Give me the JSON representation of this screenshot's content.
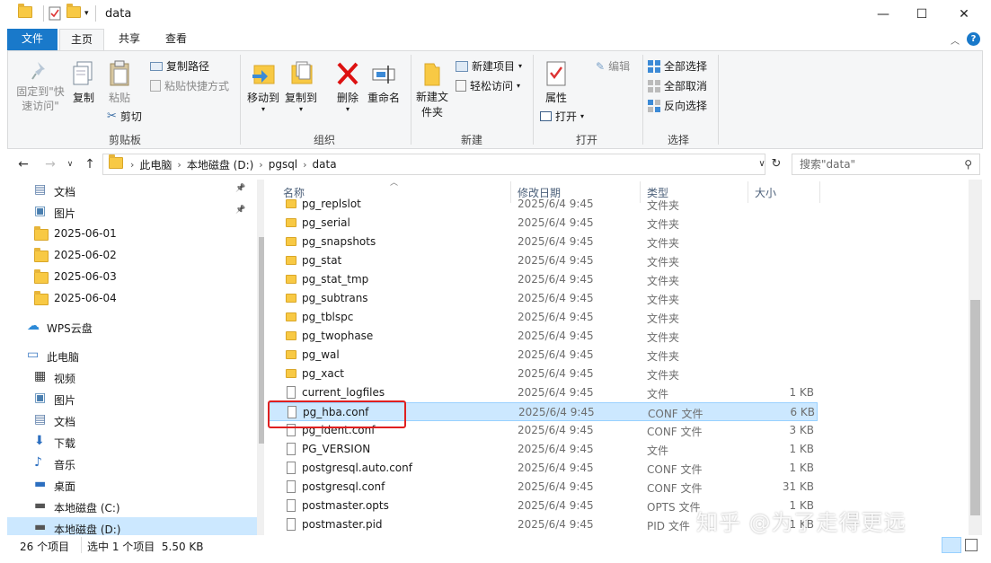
{
  "window": {
    "title": "data",
    "minimize": "—",
    "maximize": "☐",
    "close": "✕"
  },
  "ribbon_tabs": {
    "file": "文件",
    "home": "主页",
    "share": "共享",
    "view": "查看"
  },
  "ribbon": {
    "clipboard": {
      "pin": "固定到\"快速访问\"",
      "copy": "复制",
      "paste": "粘贴",
      "copy_path": "复制路径",
      "paste_shortcut": "粘贴快捷方式",
      "cut": "剪切",
      "label": "剪贴板"
    },
    "organize": {
      "move_to": "移动到",
      "copy_to": "复制到",
      "delete": "删除",
      "rename": "重命名",
      "label": "组织"
    },
    "new": {
      "new_folder": "新建文件夹",
      "new_item": "新建项目",
      "easy_access": "轻松访问",
      "label": "新建"
    },
    "open": {
      "properties": "属性",
      "open": "打开",
      "edit": "编辑",
      "label": "打开"
    },
    "select": {
      "select_all": "全部选择",
      "select_none": "全部取消",
      "invert": "反向选择",
      "label": "选择"
    }
  },
  "address": {
    "crumbs": [
      "此电脑",
      "本地磁盘 (D:)",
      "pgsql",
      "data"
    ],
    "search_placeholder": "搜索\"data\""
  },
  "nav": [
    {
      "label": "文档",
      "icon": "document-icon",
      "pinned": true
    },
    {
      "label": "图片",
      "icon": "pictures-icon",
      "pinned": true
    },
    {
      "label": "2025-06-01",
      "icon": "folder-icon"
    },
    {
      "label": "2025-06-02",
      "icon": "folder-icon"
    },
    {
      "label": "2025-06-03",
      "icon": "folder-icon"
    },
    {
      "label": "2025-06-04",
      "icon": "folder-icon"
    },
    {
      "label": "WPS云盘",
      "icon": "cloud-icon"
    },
    {
      "label": "此电脑",
      "icon": "computer-icon"
    },
    {
      "label": "视频",
      "icon": "video-icon"
    },
    {
      "label": "图片",
      "icon": "pictures-icon"
    },
    {
      "label": "文档",
      "icon": "document-icon"
    },
    {
      "label": "下载",
      "icon": "download-icon"
    },
    {
      "label": "音乐",
      "icon": "music-icon"
    },
    {
      "label": "桌面",
      "icon": "desktop-icon"
    },
    {
      "label": "本地磁盘 (C:)",
      "icon": "drive-icon"
    },
    {
      "label": "本地磁盘 (D:)",
      "icon": "drive-icon",
      "selected": true
    }
  ],
  "columns": {
    "name": "名称",
    "date": "修改日期",
    "type": "类型",
    "size": "大小"
  },
  "files": [
    {
      "name": "pg_replslot",
      "date": "2025/6/4 9:45",
      "type": "文件夹",
      "size": "",
      "kind": "folder"
    },
    {
      "name": "pg_serial",
      "date": "2025/6/4 9:45",
      "type": "文件夹",
      "size": "",
      "kind": "folder"
    },
    {
      "name": "pg_snapshots",
      "date": "2025/6/4 9:45",
      "type": "文件夹",
      "size": "",
      "kind": "folder"
    },
    {
      "name": "pg_stat",
      "date": "2025/6/4 9:45",
      "type": "文件夹",
      "size": "",
      "kind": "folder"
    },
    {
      "name": "pg_stat_tmp",
      "date": "2025/6/4 9:45",
      "type": "文件夹",
      "size": "",
      "kind": "folder"
    },
    {
      "name": "pg_subtrans",
      "date": "2025/6/4 9:45",
      "type": "文件夹",
      "size": "",
      "kind": "folder"
    },
    {
      "name": "pg_tblspc",
      "date": "2025/6/4 9:45",
      "type": "文件夹",
      "size": "",
      "kind": "folder"
    },
    {
      "name": "pg_twophase",
      "date": "2025/6/4 9:45",
      "type": "文件夹",
      "size": "",
      "kind": "folder"
    },
    {
      "name": "pg_wal",
      "date": "2025/6/4 9:45",
      "type": "文件夹",
      "size": "",
      "kind": "folder"
    },
    {
      "name": "pg_xact",
      "date": "2025/6/4 9:45",
      "type": "文件夹",
      "size": "",
      "kind": "folder"
    },
    {
      "name": "current_logfiles",
      "date": "2025/6/4 9:45",
      "type": "文件",
      "size": "1 KB",
      "kind": "file"
    },
    {
      "name": "pg_hba.conf",
      "date": "2025/6/4 9:45",
      "type": "CONF 文件",
      "size": "6 KB",
      "kind": "file",
      "selected": true
    },
    {
      "name": "pg_ident.conf",
      "date": "2025/6/4 9:45",
      "type": "CONF 文件",
      "size": "3 KB",
      "kind": "file"
    },
    {
      "name": "PG_VERSION",
      "date": "2025/6/4 9:45",
      "type": "文件",
      "size": "1 KB",
      "kind": "file"
    },
    {
      "name": "postgresql.auto.conf",
      "date": "2025/6/4 9:45",
      "type": "CONF 文件",
      "size": "1 KB",
      "kind": "file"
    },
    {
      "name": "postgresql.conf",
      "date": "2025/6/4 9:45",
      "type": "CONF 文件",
      "size": "31 KB",
      "kind": "file"
    },
    {
      "name": "postmaster.opts",
      "date": "2025/6/4 9:45",
      "type": "OPTS 文件",
      "size": "1 KB",
      "kind": "file"
    },
    {
      "name": "postmaster.pid",
      "date": "2025/6/4 9:45",
      "type": "PID 文件",
      "size": "1 KB",
      "kind": "file"
    }
  ],
  "status": {
    "count": "26 个项目",
    "selection": "选中 1 个项目  5.50 KB"
  },
  "watermark": "知乎 @为了走得更远",
  "colors": {
    "accent": "#1979ca",
    "selection": "#cce8ff",
    "highlight_box": "#e02020",
    "folder": "#f8c944"
  }
}
